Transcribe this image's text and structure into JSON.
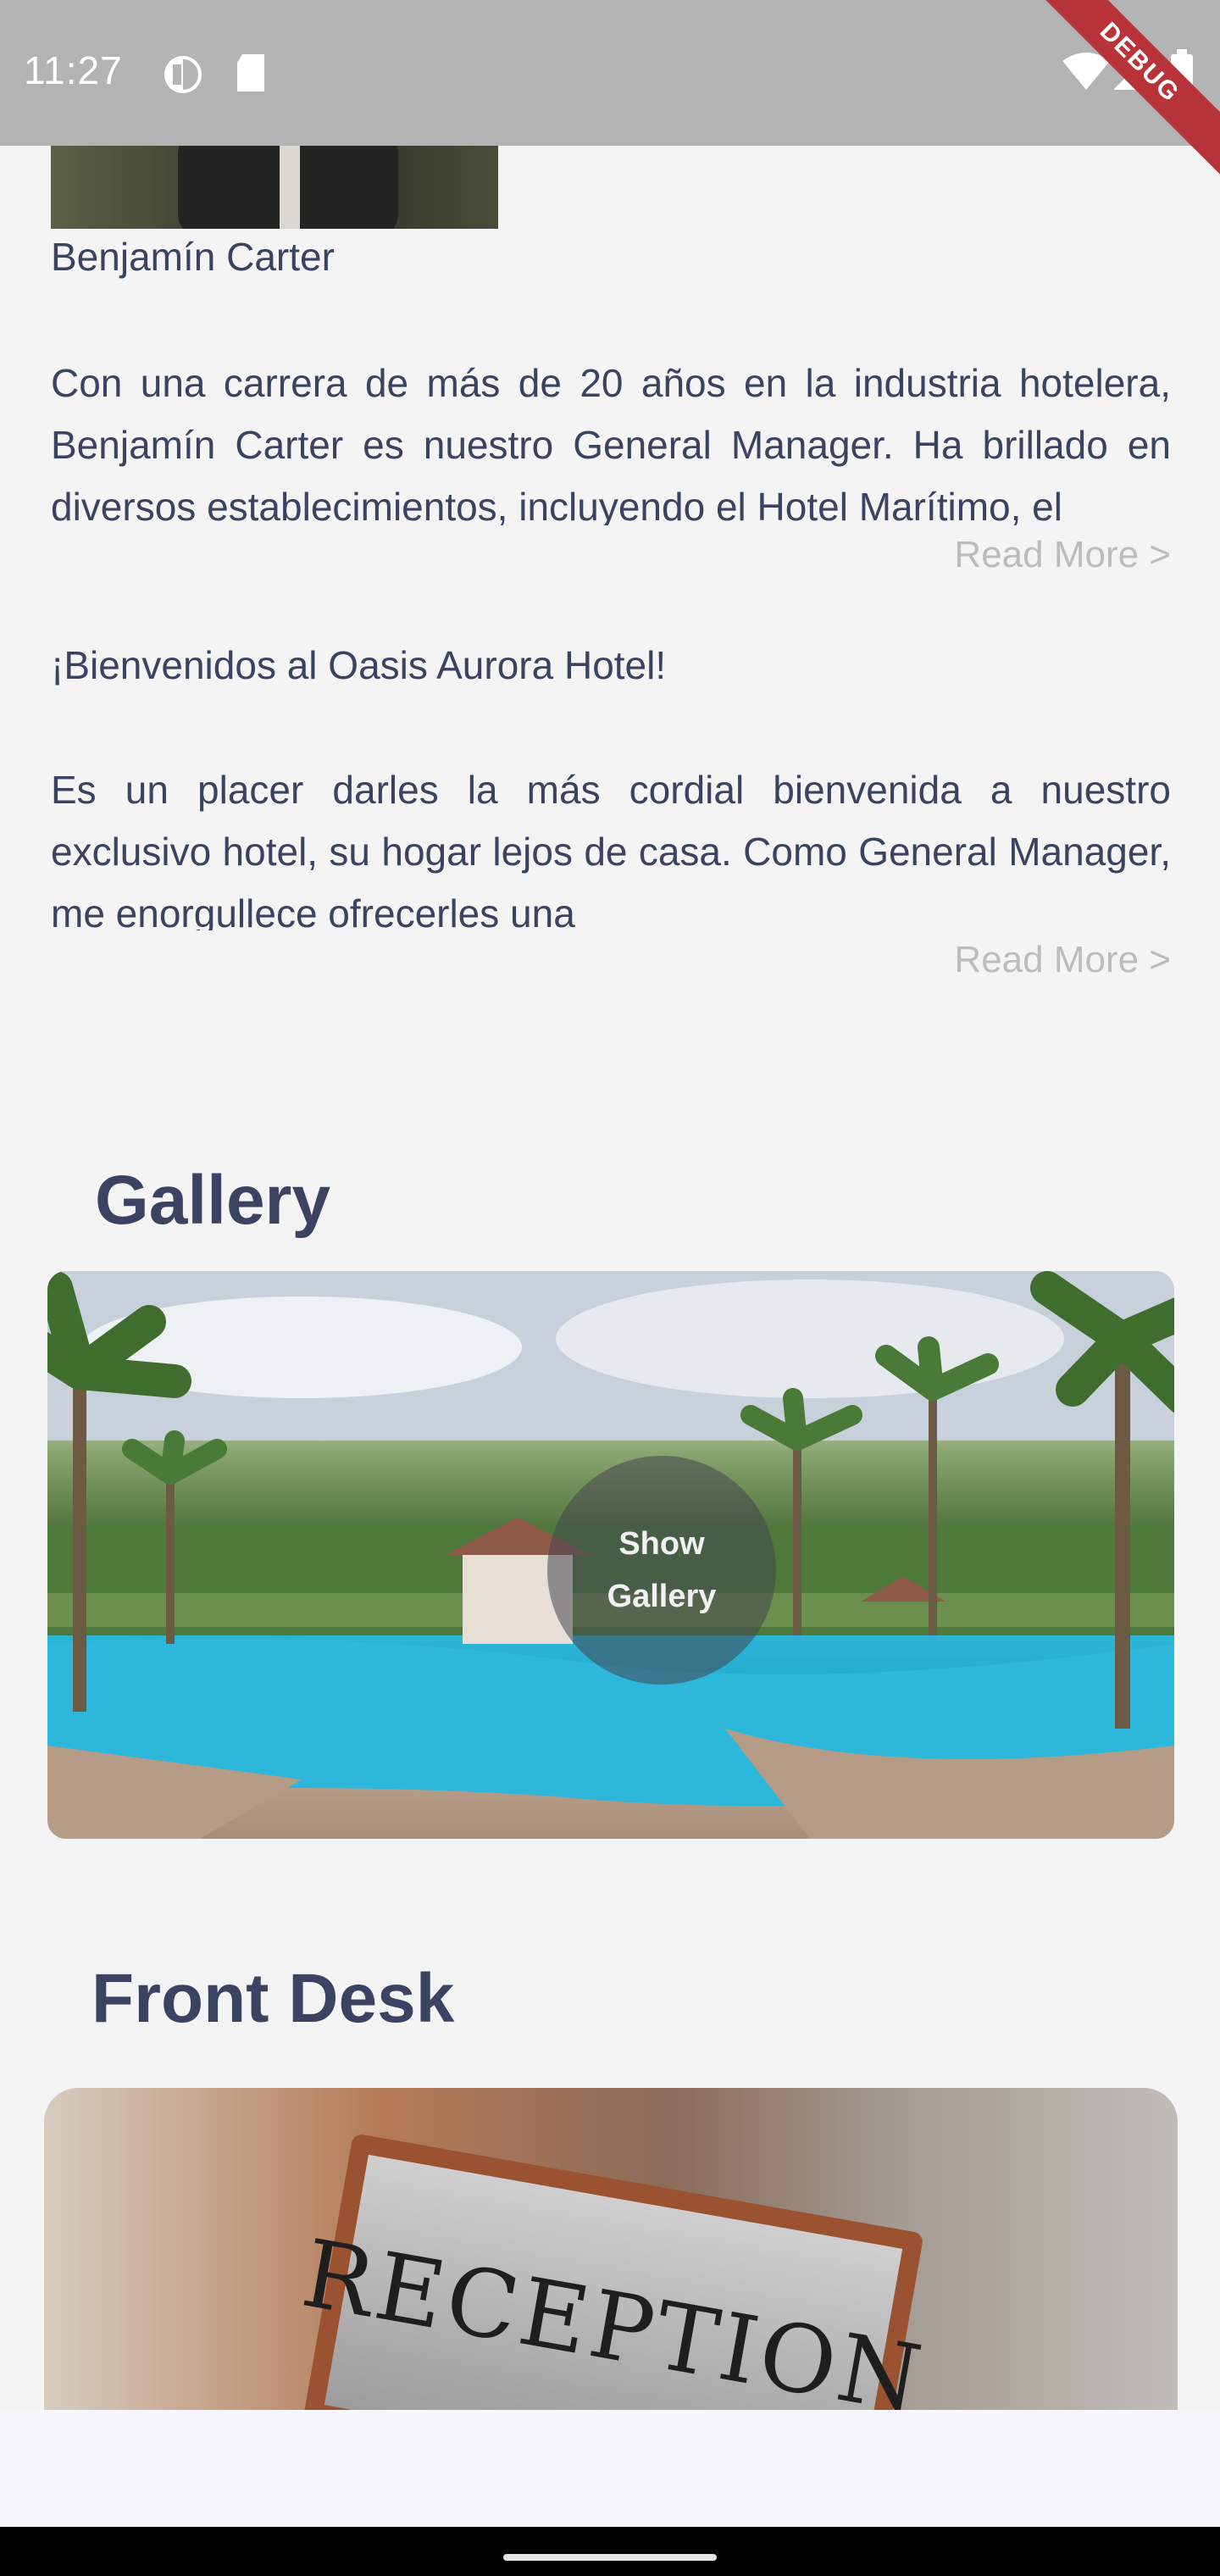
{
  "status_bar": {
    "time": "11:27",
    "debug_label": "DEBUG"
  },
  "manager": {
    "name": "Benjamín Carter",
    "bio": "Con una carrera de más de 20 años en la industria hotelera, Benjamín Carter es nuestro General Manager. Ha brillado en diversos establecimientos, incluyendo el Hotel Marítimo, el",
    "read_more": "Read More >"
  },
  "welcome": {
    "heading": "¡Bienvenidos al Oasis Aurora Hotel!",
    "body": "Es un placer darles la más cordial bienvenida a nuestro exclusivo hotel, su hogar lejos de casa. Como General Manager, me enorgullece ofrecerles una",
    "read_more": "Read More >"
  },
  "gallery": {
    "title": "Gallery",
    "button_line1": "Show",
    "button_line2": "Gallery"
  },
  "front_desk": {
    "title": "Front Desk",
    "sign_text": "RECEPTION"
  }
}
